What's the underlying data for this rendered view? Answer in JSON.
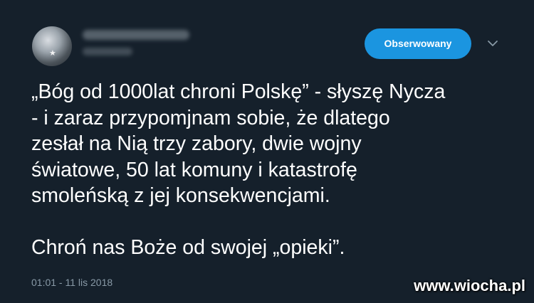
{
  "author": {
    "display_name": "",
    "handle": ""
  },
  "follow_button": {
    "label": "Obserwowany"
  },
  "menu": {
    "icon": "chevron-down-icon"
  },
  "tweet": {
    "lines": [
      "„Bóg od 1000lat chroni Polskę” - słyszę Nycza",
      "- i zaraz przypomjnam sobie, że dlatego",
      "zesłał na Nią trzy zabory, dwie wojny",
      "światowe, 50 lat komuny i katastrofę",
      "smoleńską z jej konsekwencjami."
    ],
    "closing": "Chroń nas Boże od swojej „opieki”.",
    "timestamp": "01:01 - 11 lis 2018"
  },
  "watermark": "www.wiocha.pl",
  "colors": {
    "background": "#15202b",
    "accent": "#1b95e0",
    "text": "#ffffff",
    "muted": "#8899a6"
  }
}
